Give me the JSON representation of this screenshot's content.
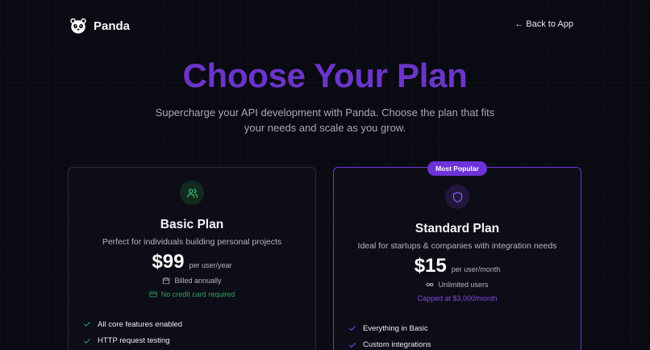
{
  "brand": {
    "name": "Panda",
    "icon": "panda-icon"
  },
  "nav": {
    "back_label": "Back to App",
    "back_arrow": "←"
  },
  "hero": {
    "title": "Choose Your Plan",
    "subtitle": "Supercharge your API development with Panda. Choose the plan that fits your needs and scale as you grow."
  },
  "colors": {
    "accent": "#6d33d9",
    "basic_accent": "#2fa35b",
    "background": "#0a0a13"
  },
  "plans": [
    {
      "name": "Basic Plan",
      "description": "Perfect for individuals building personal projects",
      "price": "$99",
      "price_unit": "per user/year",
      "icon": "users-icon",
      "meta": [
        {
          "icon": "calendar-icon",
          "text": "Billed annually"
        },
        {
          "icon": "credit-card-icon",
          "text": "No credit card required"
        }
      ],
      "features": [
        "All core features enabled",
        "HTTP request testing"
      ]
    },
    {
      "name": "Standard Plan",
      "badge": "Most Popular",
      "description": "Ideal for startups & companies with integration needs",
      "price": "$15",
      "price_unit": "per user/month",
      "icon": "shield-icon",
      "meta": [
        {
          "icon": "infinity-icon",
          "text": "Unlimited users"
        },
        {
          "text": "Capped at $3,000/month"
        }
      ],
      "features": [
        "Everything in Basic",
        "Custom integrations"
      ]
    }
  ]
}
